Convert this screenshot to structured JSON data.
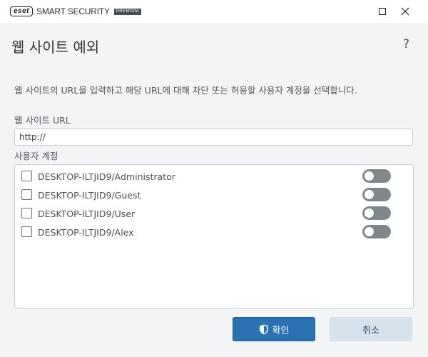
{
  "app": {
    "brand": "eset",
    "product": "SMART SECURITY",
    "edition": "PREMIUM"
  },
  "window_controls": {
    "maximize_icon": "maximize-icon",
    "close_icon": "close-icon"
  },
  "header": {
    "title": "웹 사이트 예외",
    "help": "?"
  },
  "form": {
    "description": "웹 사이트의 URL을 입력하고 해당 URL에 대해 차단 또는 허용할 사용자 계정을 선택합니다.",
    "url_label": "웹 사이트 URL",
    "url_value": "http://",
    "accounts_label": "사용자 계정",
    "accounts": [
      {
        "name": "DESKTOP-ILTJID9/Administrator",
        "checked": false,
        "toggle": "off"
      },
      {
        "name": "DESKTOP-ILTJID9/Guest",
        "checked": false,
        "toggle": "off"
      },
      {
        "name": "DESKTOP-ILTJID9/User",
        "checked": false,
        "toggle": "off"
      },
      {
        "name": "DESKTOP-ILTJID9/Alex",
        "checked": false,
        "toggle": "off"
      }
    ]
  },
  "buttons": {
    "ok_label": "확인",
    "cancel_label": "취소"
  },
  "colors": {
    "primary": "#2b72b3",
    "secondary": "#d6e2ec",
    "toggle_off": "#808689"
  }
}
